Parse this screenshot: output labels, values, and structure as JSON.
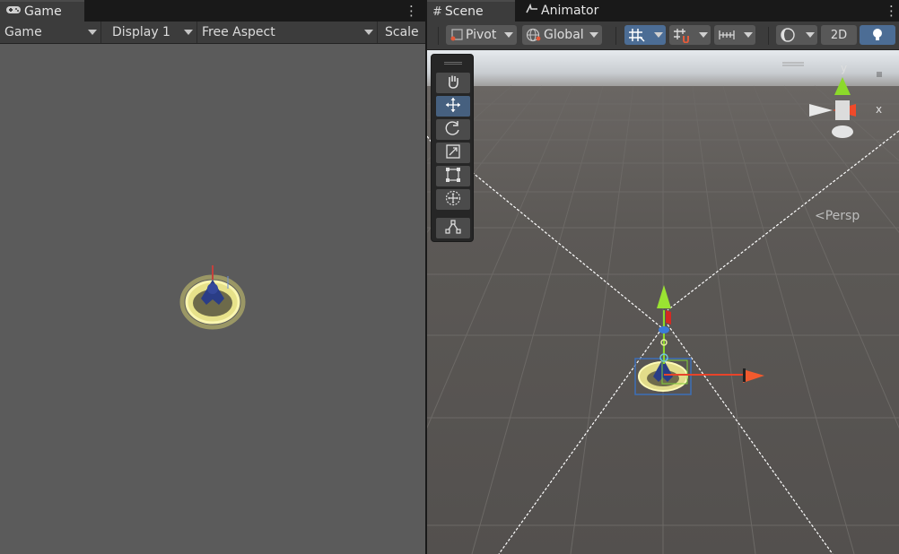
{
  "game": {
    "tab_label": "Game",
    "tab_icon": "gamepad-icon",
    "toolbar": {
      "mode": "Game",
      "display": "Display 1",
      "aspect": "Free Aspect",
      "scale_label": "Scale"
    },
    "background": "#5b5b5b"
  },
  "scene": {
    "tabs": [
      {
        "label": "Scene",
        "icon": "grid-icon"
      },
      {
        "label": "Animator",
        "icon": "animator-icon"
      }
    ],
    "toolbar": {
      "pivot": "Pivot",
      "space": "Global",
      "mode_2d": "2D"
    },
    "tools": [
      "hand-tool",
      "move-tool",
      "rotate-tool",
      "scale-tool",
      "rect-tool",
      "transform-tool",
      "custom-tool"
    ],
    "active_tool": "move-tool",
    "gizmo": {
      "y_label": "y",
      "x_label": "x",
      "projection": "Persp"
    },
    "colors": {
      "x_axis": "#e8442a",
      "y_axis": "#8cd92a",
      "z_axis": "#3b7bd8",
      "sky": "#d8dde2",
      "ground": "#595653"
    }
  }
}
